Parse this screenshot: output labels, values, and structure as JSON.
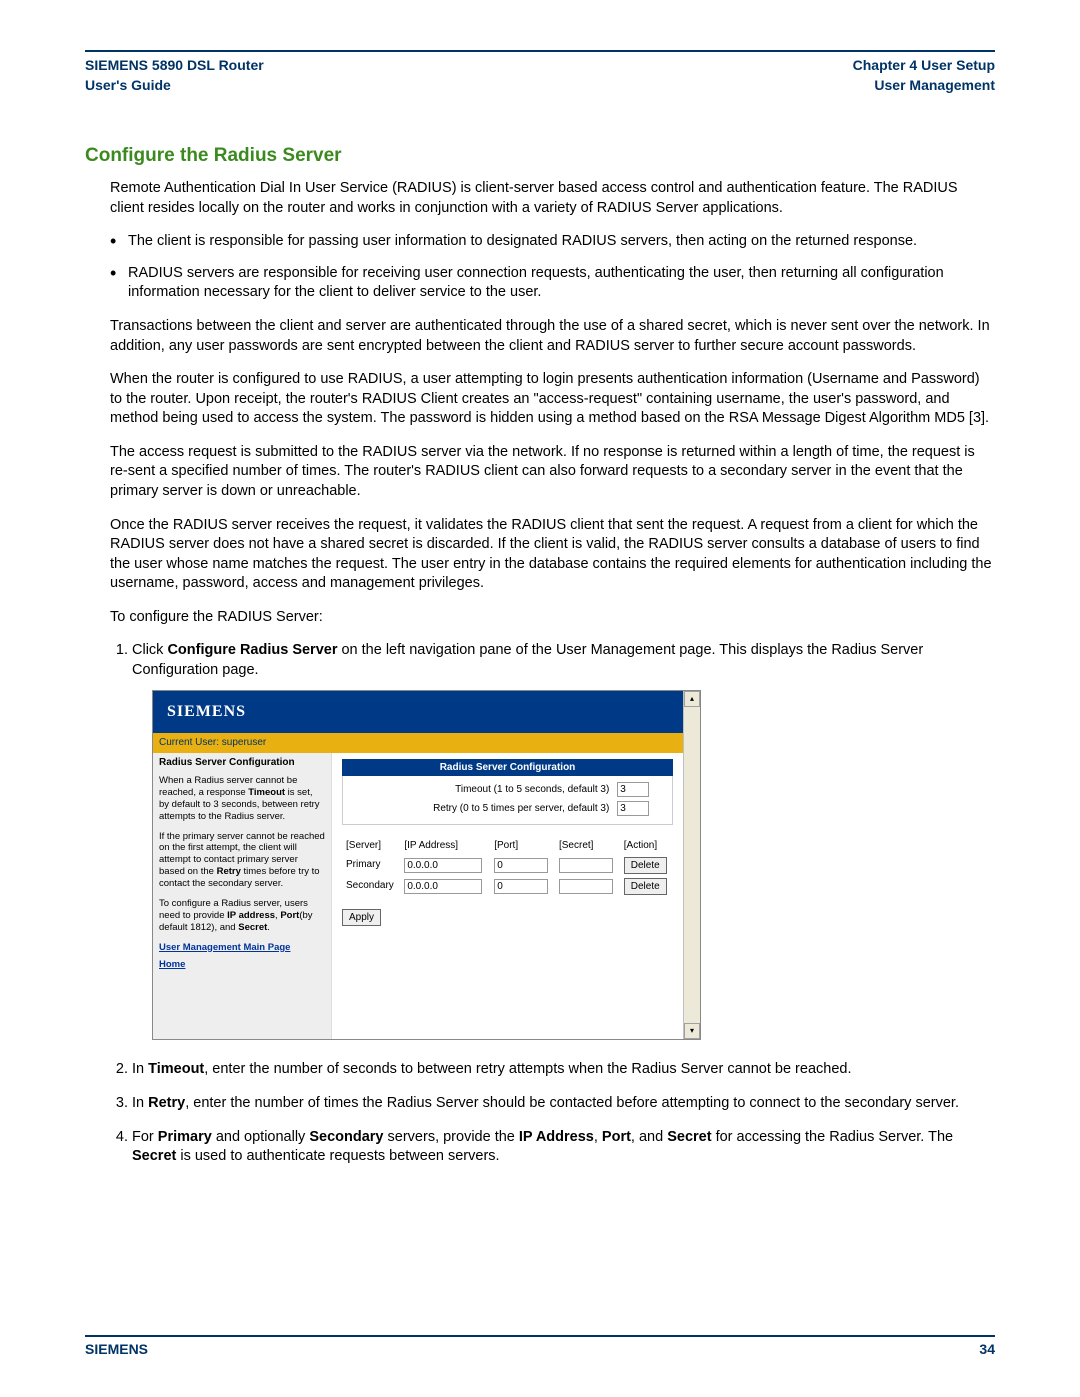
{
  "header": {
    "left_line1": "SIEMENS 5890 DSL Router",
    "left_line2": "User's Guide",
    "right_line1": "Chapter 4  User Setup",
    "right_line2": "User Management"
  },
  "section_title": "Configure the Radius Server",
  "intro": "Remote Authentication Dial In User Service (RADIUS) is client-server based access control and authentication feature. The RADIUS client resides locally on the router and works in conjunction with a variety of RADIUS Server applications.",
  "bullets": [
    "The client is responsible for passing user information to designated RADIUS servers, then acting on the returned response.",
    "RADIUS servers are responsible for receiving user connection requests, authenticating the user, then returning all configuration information necessary for the client to deliver service to the user."
  ],
  "paragraphs": [
    "Transactions between the client and server are authenticated through the use of a shared secret, which is never sent over the network. In addition, any user passwords are sent encrypted between the client and RADIUS server to further secure account passwords.",
    "When the router is configured to use RADIUS, a user attempting to login presents authentication information (Username and Password) to the router. Upon receipt, the router's RADIUS Client creates an \"access-request\" containing username, the user's password, and method being used to access the system. The password is hidden using a method based on the RSA Message Digest Algorithm MD5 [3].",
    "The access request is submitted to the RADIUS server via the network. If no response is returned within a length of time, the request is re-sent a specified number of times. The router's RADIUS client can also forward requests to a secondary server in the event that the primary server is down or unreachable.",
    "Once the RADIUS server receives the request, it validates the RADIUS client that sent the request. A request from a client for which the RADIUS server does not have a shared secret is discarded. If the client is valid, the RADIUS server consults a database of users to find the user whose name matches the request. The user entry in the database contains the required elements for authentication including the username, password, access and management privileges.",
    "To configure the RADIUS Server:"
  ],
  "step1_prefix": "Click ",
  "step1_bold": "Configure Radius Server",
  "step1_suffix": " on the left navigation pane of the User Management page. This displays the Radius Server Configuration page.",
  "step2_prefix": "In ",
  "step2_bold": "Timeout",
  "step2_suffix": ", enter the number of seconds to between retry attempts when the Radius Server cannot be reached.",
  "step3_prefix": "In ",
  "step3_bold": "Retry",
  "step3_suffix": ", enter the number of times the Radius Server should be contacted before attempting to connect to the secondary server.",
  "step4": {
    "p1": "For ",
    "b1": "Primary",
    "p2": " and optionally ",
    "b2": "Secondary",
    "p3": " servers, provide the ",
    "b3": "IP Address",
    "p4": ", ",
    "b4": "Port",
    "p5": ", and ",
    "b5": "Secret",
    "p6": " for accessing the Radius Server. The ",
    "b6": "Secret",
    "p7": " is used to authenticate requests between servers."
  },
  "embed": {
    "brand": "SIEMENS",
    "current_user": "Current User: superuser",
    "sidebar": {
      "title": "Radius Server Configuration",
      "p1a": "When a Radius server cannot be reached, a response ",
      "p1b": "Timeout",
      "p1c": " is set, by default to 3 seconds, between retry attempts to the Radius server.",
      "p2a": "If the primary server cannot be reached on the first attempt, the client will attempt to contact primary server based on the ",
      "p2b": "Retry",
      "p2c": " times before try to contact the secondary server.",
      "p3a": "To configure a Radius server, users need to provide ",
      "p3b": "IP address",
      "p3c": ", ",
      "p3d": "Port",
      "p3e": "(by default 1812), and ",
      "p3f": "Secret",
      "p3g": ".",
      "link1": "User Management Main Page",
      "link2": "Home"
    },
    "config": {
      "header": "Radius Server Configuration",
      "timeout_label": "Timeout (1 to 5 seconds, default 3)",
      "timeout_value": "3",
      "retry_label": "Retry (0 to 5 times per server, default 3)",
      "retry_value": "3",
      "columns": {
        "server": "[Server]",
        "ip": "[IP Address]",
        "port": "[Port]",
        "secret": "[Secret]",
        "action": "[Action]"
      },
      "rows": [
        {
          "server": "Primary",
          "ip": "0.0.0.0",
          "port": "0",
          "secret": "",
          "action": "Delete"
        },
        {
          "server": "Secondary",
          "ip": "0.0.0.0",
          "port": "0",
          "secret": "",
          "action": "Delete"
        }
      ],
      "apply": "Apply"
    },
    "scroll": {
      "up": "▴",
      "down": "▾"
    }
  },
  "footer": {
    "brand": "SIEMENS",
    "page": "34"
  }
}
